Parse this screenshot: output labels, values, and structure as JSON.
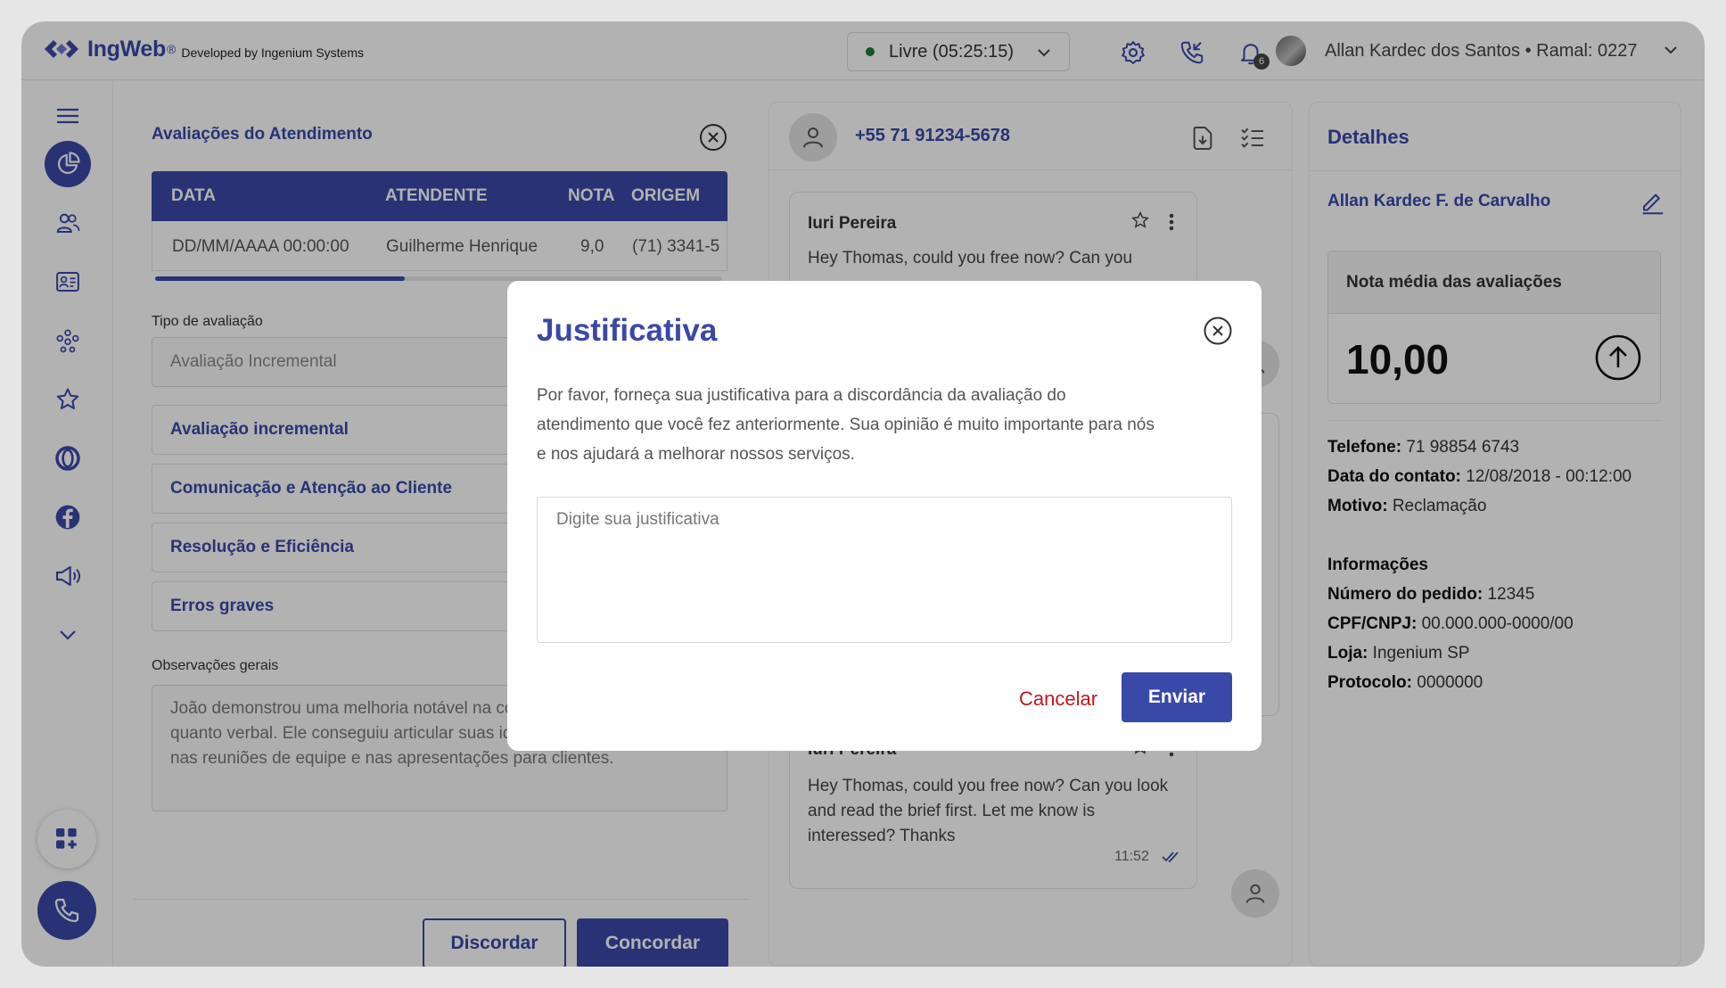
{
  "app": {
    "logo_text": "IngWeb",
    "logo_reg": "®",
    "logo_sub": "Developed by Ingenium Systems",
    "brand_color": "#3a48a8"
  },
  "topbar": {
    "status_label": "Livre (05:25:15)",
    "notification_count": "6",
    "user_label": "Allan Kardec dos Santos • Ramal: 0227"
  },
  "sidebar": {
    "items": [
      "menu-icon",
      "dashboard-icon",
      "users-icon",
      "contact-card-icon",
      "team-icon",
      "star-icon",
      "omni-icon",
      "facebook-icon",
      "megaphone-icon",
      "chevron-down-icon"
    ]
  },
  "evaluations": {
    "title": "Avaliações do Atendimento",
    "columns": [
      "DATA",
      "ATENDENTE",
      "NOTA",
      "ORIGEM"
    ],
    "rows": [
      [
        "DD/MM/AAAA 00:00:00",
        "Guilherme Henrique",
        "9,0",
        "(71) 3341-5"
      ]
    ],
    "type_label": "Tipo de avaliação",
    "type_value": "Avaliação Incremental",
    "sections": [
      "Avaliação incremental",
      "Comunicação e Atenção ao Cliente",
      "Resolução e Eficiência",
      "Erros graves"
    ],
    "obs_label": "Observações gerais",
    "obs_text": "João demonstrou uma melhoria notável na comunicação, tanto escrita quanto verbal. Ele conseguiu articular suas ideias de forma mais clara nas reuniões de equipe e nas apresentações para clientes.",
    "disagree_label": "Discordar",
    "agree_label": "Concordar"
  },
  "chat": {
    "phone": "+55 71 91234-5678",
    "messages": [
      {
        "name": "Iuri Pereira",
        "text": "Hey Thomas, could you free now? Can you",
        "time": ""
      },
      {
        "name": "Iuri Pereira",
        "text": "Hey Thomas, could you free now? Can you look and read the brief first. Let me know is interessed? Thanks",
        "time": "11:52"
      }
    ]
  },
  "details": {
    "title": "Detalhes",
    "name": "Allan Kardec F. de Carvalho",
    "score_label": "Nota média das avaliações",
    "score_value": "10,00",
    "fields": [
      {
        "label": "Telefone:",
        "value": " 71 98854 6743"
      },
      {
        "label": "Data do contato:",
        "value": " 12/08/2018 - 00:12:00"
      },
      {
        "label": "Motivo:",
        "value": " Reclamação"
      }
    ],
    "info_title": "Informações",
    "info_fields": [
      {
        "label": "Número do pedido:",
        "value": " 12345"
      },
      {
        "label": "CPF/CNPJ:",
        "value": " 00.000.000-0000/00"
      },
      {
        "label": "Loja:",
        "value": " Ingenium SP"
      },
      {
        "label": "Protocolo:",
        "value": " 0000000"
      }
    ]
  },
  "modal": {
    "title": "Justificativa",
    "text": "Por favor, forneça sua justificativa para a discordância da avaliação do atendimento que você fez anteriormente. Sua opinião é muito importante para nós e nos ajudará a melhorar nossos serviços.",
    "placeholder": "Digite sua justificativa",
    "cancel_label": "Cancelar",
    "send_label": "Enviar"
  }
}
